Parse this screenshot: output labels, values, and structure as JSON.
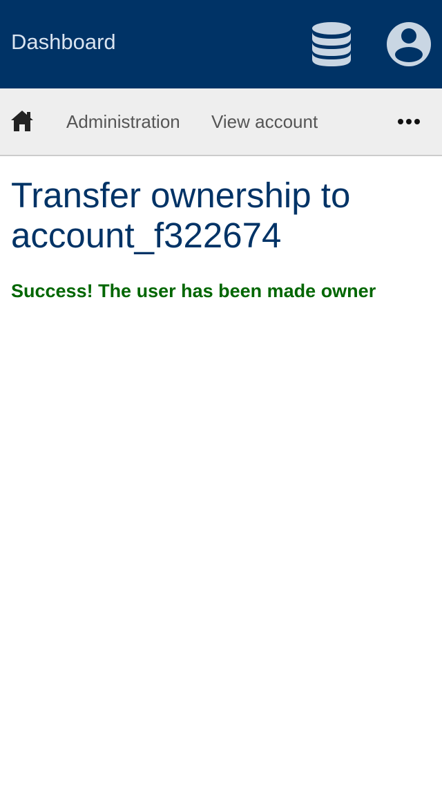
{
  "header": {
    "title": "Dashboard",
    "database_icon": "database-icon",
    "account_icon": "user-circle-icon",
    "background_color": "#003366"
  },
  "nav": {
    "home_icon": "home-icon",
    "items": [
      {
        "label": "Administration"
      },
      {
        "label": "View account"
      }
    ],
    "more_icon": "more-horizontal-icon"
  },
  "page": {
    "heading": "Transfer ownership to account_f322674",
    "message": "Success! The user has been made owner",
    "message_color": "#006600"
  }
}
